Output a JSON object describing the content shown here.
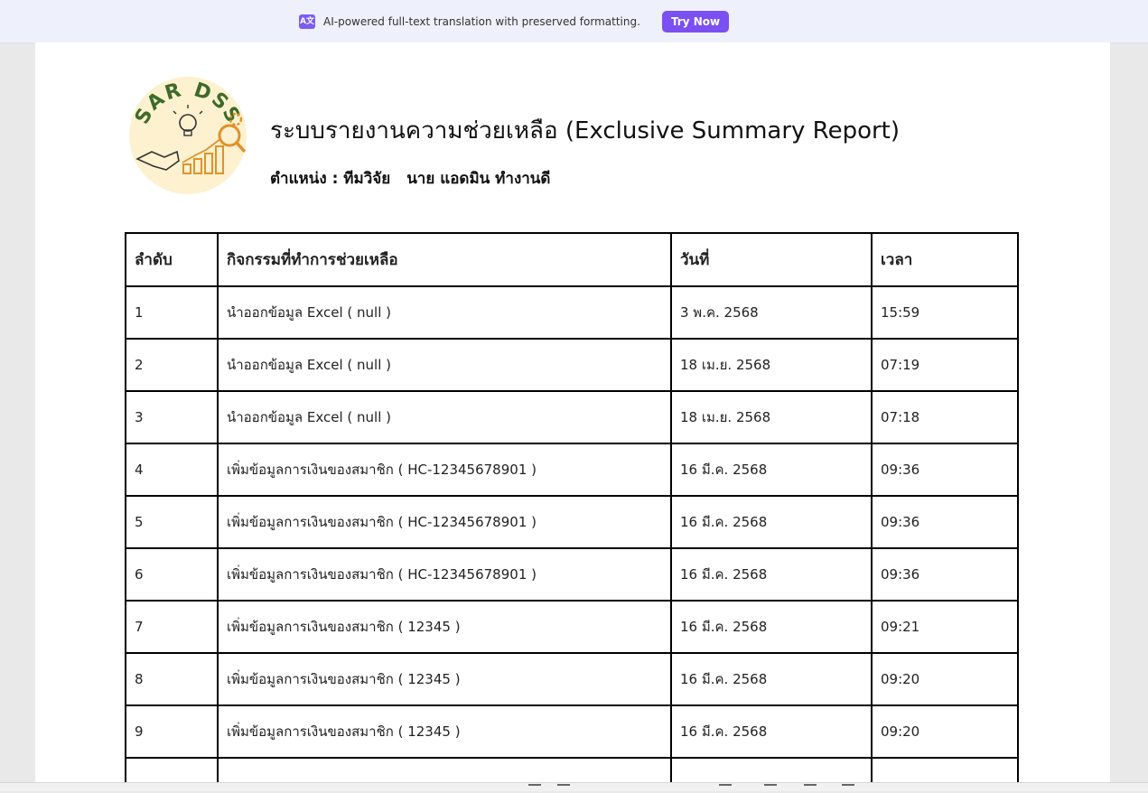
{
  "banner": {
    "icon": "translate-icon",
    "icon_text": "A文",
    "text": "AI-powered full-text translation with preserved formatting.",
    "button_label": "Try Now",
    "accent_color": "#7b4ff2"
  },
  "report": {
    "logo_text": "SAR DSS",
    "title": "ระบบรายงานความช่วยเหลือ (Exclusive Summary Report)",
    "position_label": "ตำแหน่ง : ทีมวิจัย",
    "person_name": "นาย แอดมิน ทำงานดี"
  },
  "table": {
    "headers": [
      "ลำดับ",
      "กิจกรรมที่ทำการช่วยเหลือ",
      "วันที่",
      "เวลา"
    ],
    "rows": [
      [
        "1",
        "นำออกข้อมูล Excel ( null )",
        "3 พ.ค. 2568",
        "15:59"
      ],
      [
        "2",
        "นำออกข้อมูล Excel ( null )",
        "18 เม.ย. 2568",
        "07:19"
      ],
      [
        "3",
        "นำออกข้อมูล Excel ( null )",
        "18 เม.ย. 2568",
        "07:18"
      ],
      [
        "4",
        "เพิ่มข้อมูลการเงินของสมาชิก ( HC-12345678901 )",
        "16 มี.ค. 2568",
        "09:36"
      ],
      [
        "5",
        "เพิ่มข้อมูลการเงินของสมาชิก ( HC-12345678901 )",
        "16 มี.ค. 2568",
        "09:36"
      ],
      [
        "6",
        "เพิ่มข้อมูลการเงินของสมาชิก ( HC-12345678901 )",
        "16 มี.ค. 2568",
        "09:36"
      ],
      [
        "7",
        "เพิ่มข้อมูลการเงินของสมาชิก ( 12345 )",
        "16 มี.ค. 2568",
        "09:21"
      ],
      [
        "8",
        "เพิ่มข้อมูลการเงินของสมาชิก ( 12345 )",
        "16 มี.ค. 2568",
        "09:20"
      ],
      [
        "9",
        "เพิ่มข้อมูลการเงินของสมาชิก ( 12345 )",
        "16 มี.ค. 2568",
        "09:20"
      ]
    ]
  }
}
